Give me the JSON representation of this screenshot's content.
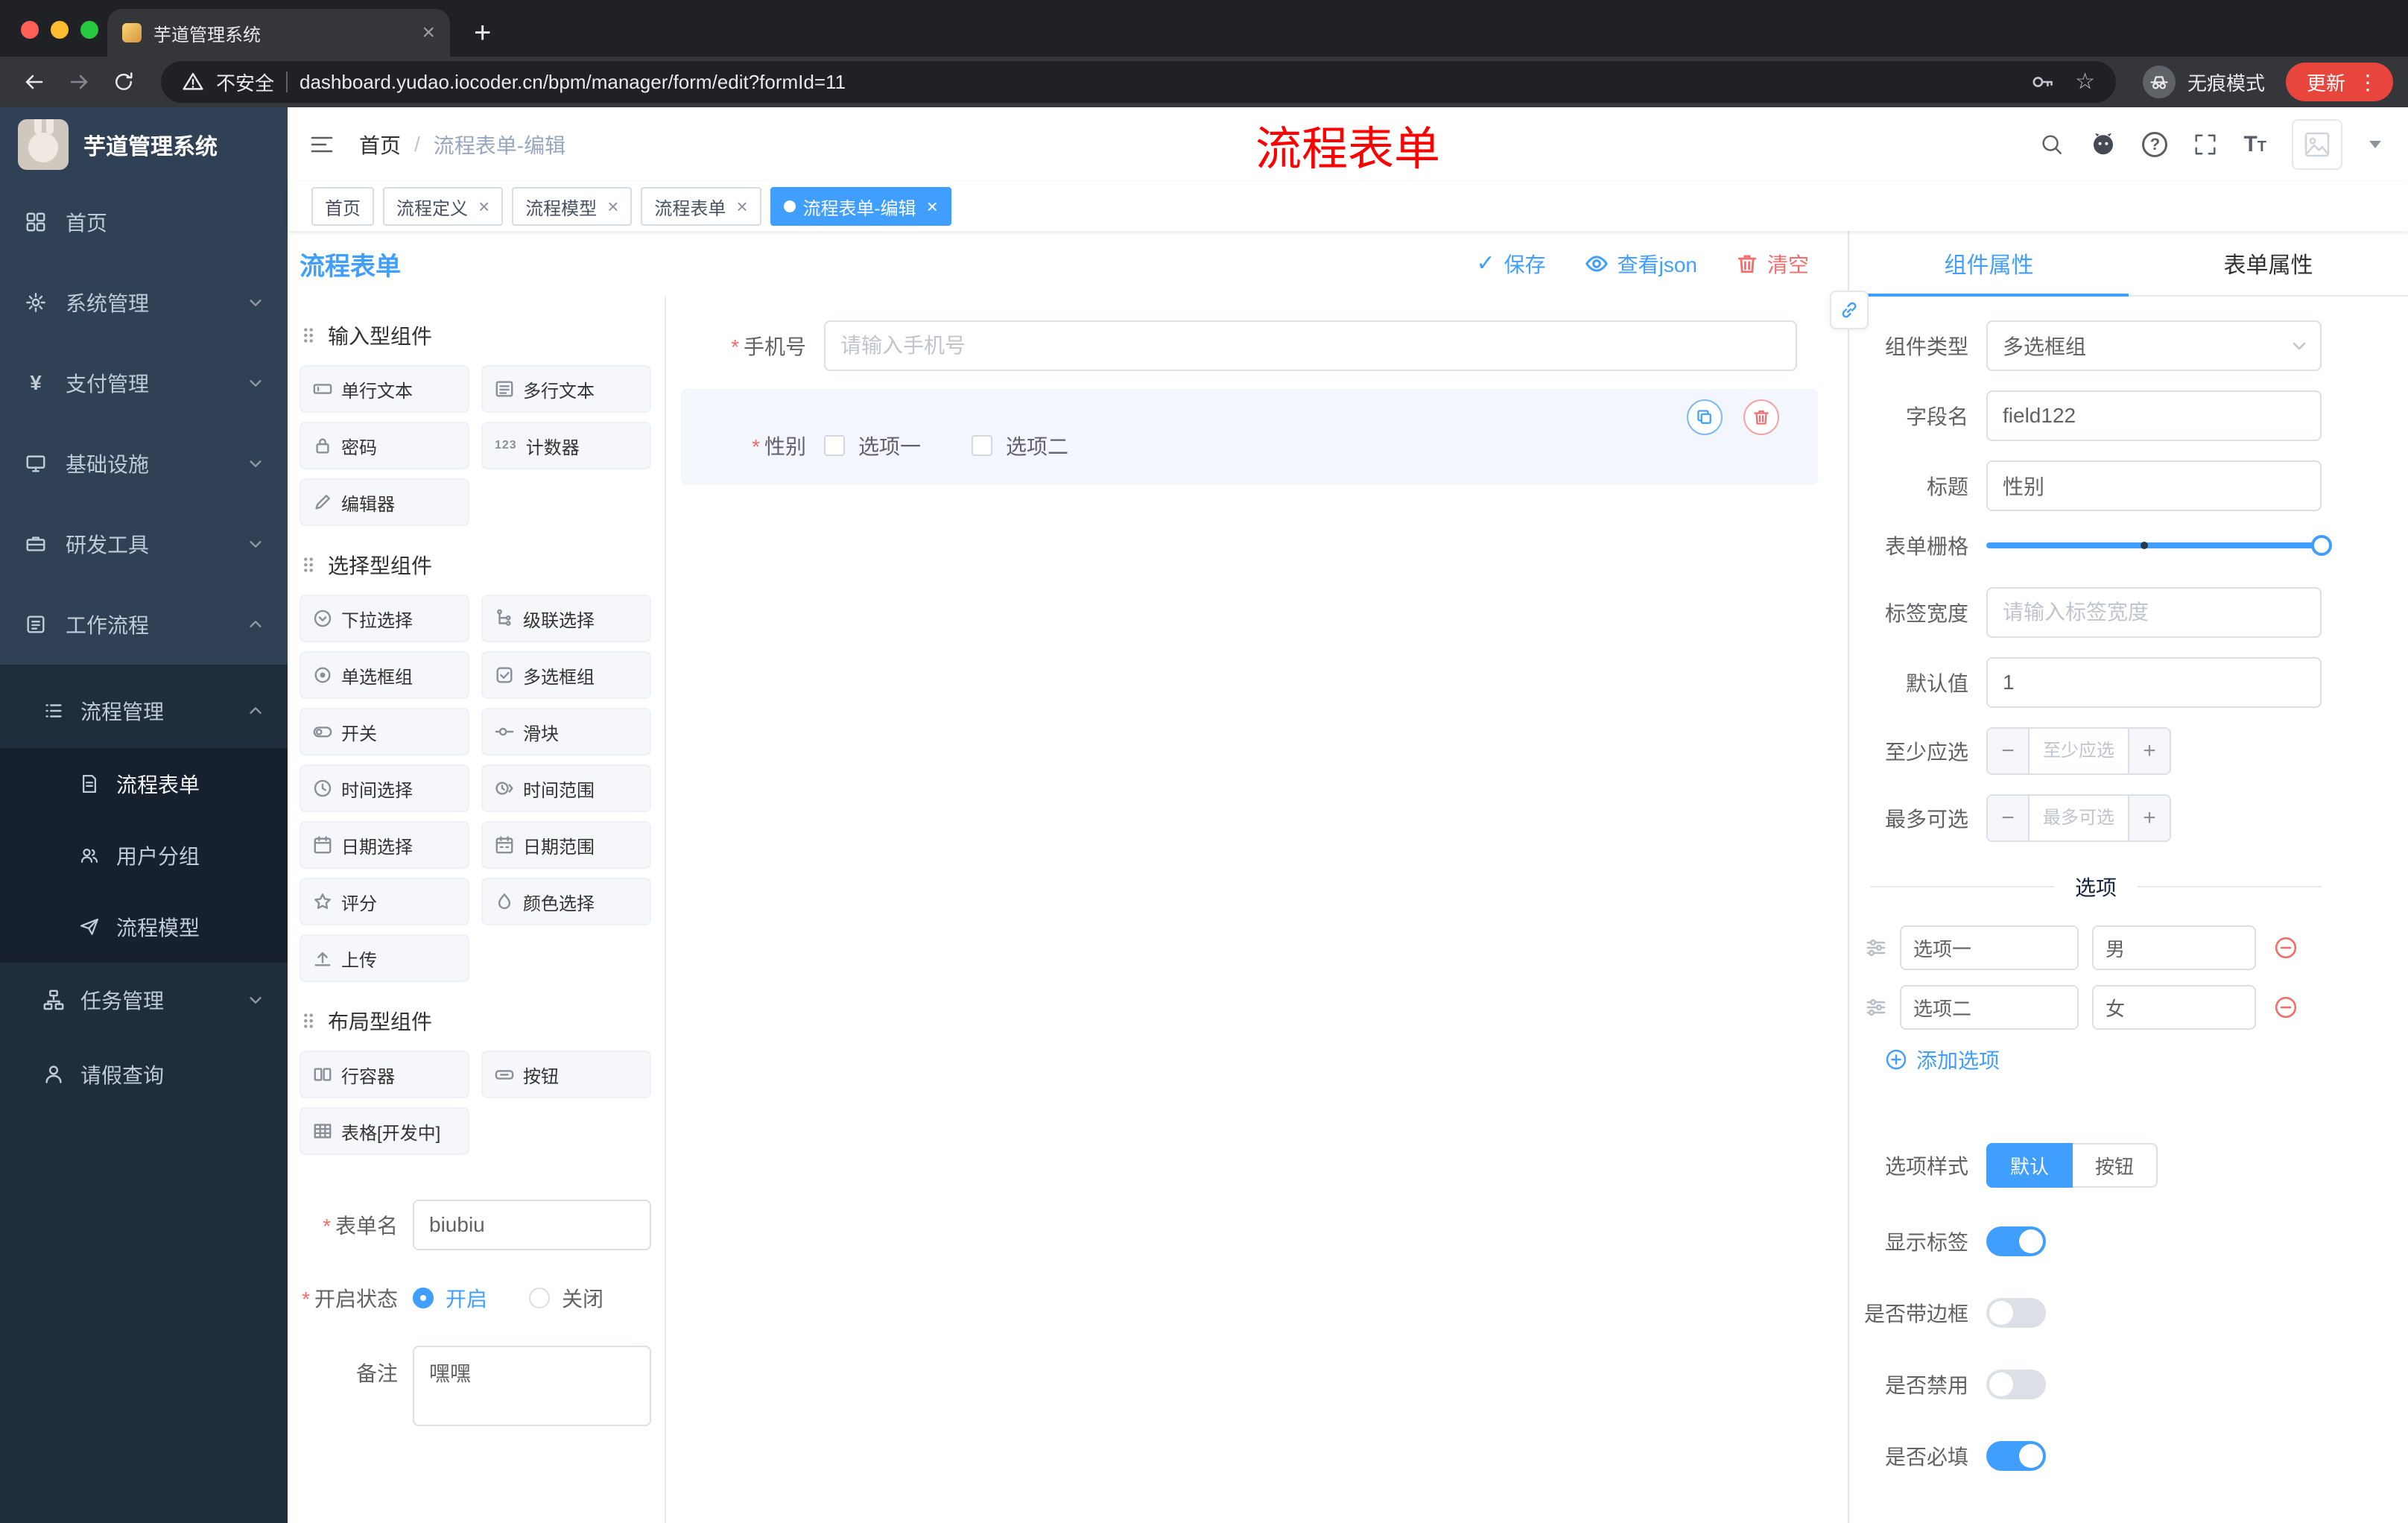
{
  "theme": {
    "primary": "#409EFF",
    "danger": "#F56C6C",
    "annotation_red": "#FE0000",
    "sidebar_bg": "#304156",
    "sidebar_submenu_bg": "#1F2D3D",
    "update_button_bg": "#E8453C"
  },
  "icons": {
    "traffic_lights": "close-minimize-zoom",
    "back": "arrow-left",
    "forward": "arrow-right",
    "reload": "circular-arrow",
    "security": "warning-triangle",
    "key": "key",
    "bookmark": "star",
    "incognito": "hat-and-glasses",
    "menu": "three-dots",
    "hamburger": "menu-lines",
    "search": "magnifier",
    "github": "octocat",
    "help": "question-circle",
    "fullscreen": "corner-brackets",
    "font_size": "T",
    "save": "check",
    "view_json": "eye",
    "clear": "trash",
    "copy": "duplicate-squares",
    "delete": "trash",
    "link": "chain",
    "section_drag": "grip-dots",
    "option_drag": "sliders",
    "remove_option": "minus-circle",
    "add_option": "plus-circle"
  },
  "browser": {
    "tab_title": "芋道管理系统",
    "new_tab": "+",
    "security_label": "不安全",
    "url": "dashboard.yudao.iocoder.cn/bpm/manager/form/edit?formId=11",
    "incognito_label": "无痕模式",
    "update_label": "更新"
  },
  "header": {
    "breadcrumb": {
      "home": "首页",
      "current": "流程表单-编辑"
    },
    "annotation": "流程表单"
  },
  "sidebar": {
    "logo_title": "芋道管理系统",
    "menu": [
      {
        "label": "首页"
      },
      {
        "label": "系统管理"
      },
      {
        "label": "支付管理"
      },
      {
        "label": "基础设施"
      },
      {
        "label": "研发工具"
      },
      {
        "label": "工作流程"
      }
    ],
    "process_group": {
      "label": "流程管理",
      "children": [
        "流程表单",
        "用户分组",
        "流程模型"
      ]
    },
    "task_group_label": "任务管理",
    "leave_label": "请假查询"
  },
  "tags": [
    {
      "label": "首页"
    },
    {
      "label": "流程定义"
    },
    {
      "label": "流程模型"
    },
    {
      "label": "流程表单"
    },
    {
      "label": "流程表单-编辑",
      "active": true
    }
  ],
  "designer": {
    "title": "流程表单",
    "actions": {
      "save": "保存",
      "view_json": "查看json",
      "clear": "清空"
    },
    "component_sections": [
      {
        "title": "输入型组件",
        "items": [
          "单行文本",
          "多行文本",
          "密码",
          "计数器",
          "编辑器"
        ]
      },
      {
        "title": "选择型组件",
        "items": [
          "下拉选择",
          "级联选择",
          "单选框组",
          "多选框组",
          "开关",
          "滑块",
          "时间选择",
          "时间范围",
          "日期选择",
          "日期范围",
          "评分",
          "颜色选择",
          "上传"
        ]
      },
      {
        "title": "布局型组件",
        "items": [
          "行容器",
          "按钮",
          "表格[开发中]"
        ]
      }
    ],
    "meta_form": {
      "name_label": "表单名",
      "name_value": "biubiu",
      "status_label": "开启状态",
      "status_on": "开启",
      "status_off": "关闭",
      "remark_label": "备注",
      "remark_value": "嘿嘿"
    },
    "canvas": {
      "phone": {
        "label": "手机号",
        "placeholder": "请输入手机号"
      },
      "gender": {
        "label": "性别",
        "options": [
          "选项一",
          "选项二"
        ]
      }
    }
  },
  "properties": {
    "tabs": {
      "component": "组件属性",
      "form": "表单属性"
    },
    "component_type_label": "组件类型",
    "component_type_value": "多选框组",
    "field_name_label": "字段名",
    "field_name_value": "field122",
    "title_label": "标题",
    "title_value": "性别",
    "grid_label": "表单栅格",
    "label_width_label": "标签宽度",
    "label_width_placeholder": "请输入标签宽度",
    "default_label": "默认值",
    "default_value": "1",
    "min_label": "至少应选",
    "min_placeholder": "至少应选",
    "max_label": "最多可选",
    "max_placeholder": "最多可选",
    "options_divider": "选项",
    "options": [
      {
        "label": "选项一",
        "value": "男"
      },
      {
        "label": "选项二",
        "value": "女"
      }
    ],
    "add_option": "添加选项",
    "style_label": "选项样式",
    "style_default": "默认",
    "style_button": "按钮",
    "toggles": [
      {
        "label": "显示标签",
        "on": true
      },
      {
        "label": "是否带边框",
        "on": false
      },
      {
        "label": "是否禁用",
        "on": false
      },
      {
        "label": "是否必填",
        "on": true
      }
    ]
  }
}
